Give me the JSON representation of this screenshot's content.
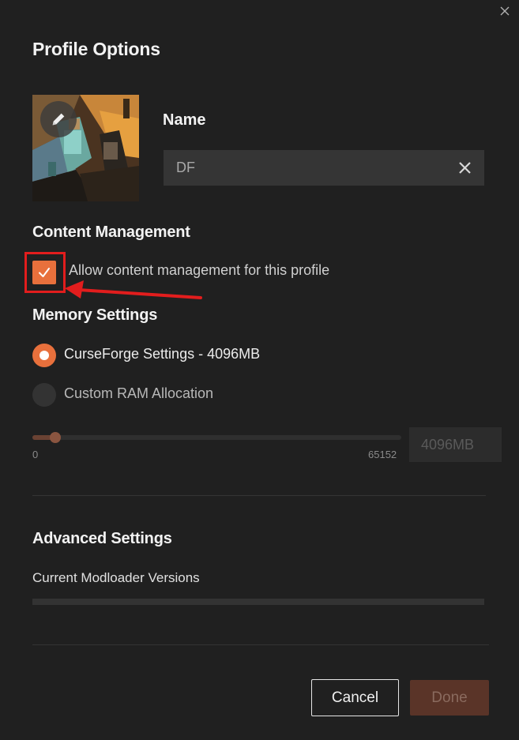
{
  "dialog": {
    "title": "Profile Options",
    "close_icon": "close-icon"
  },
  "profile": {
    "avatar_icon": "pencil-icon",
    "name_label": "Name",
    "name_value": "DF",
    "clear_icon": "clear-x-icon"
  },
  "content_management": {
    "title": "Content Management",
    "checkbox_checked": true,
    "checkbox_label": "Allow content management for this profile"
  },
  "memory": {
    "title": "Memory Settings",
    "options": [
      {
        "label": "CurseForge Settings - 4096MB",
        "selected": true
      },
      {
        "label": "Custom RAM Allocation",
        "selected": false
      }
    ],
    "slider_min": "0",
    "slider_max": "65152",
    "slider_value_mb": 4096,
    "ram_value": "4096MB"
  },
  "advanced": {
    "title": "Advanced Settings",
    "modloader_label": "Current Modloader Versions"
  },
  "footer": {
    "cancel_label": "Cancel",
    "done_label": "Done"
  },
  "colors": {
    "accent": "#e8703c",
    "background": "#202020",
    "annotation": "#e21d1d"
  }
}
